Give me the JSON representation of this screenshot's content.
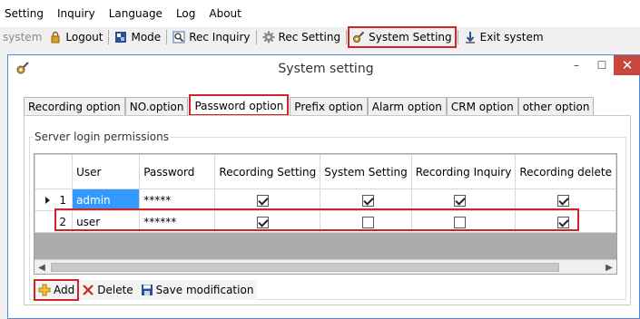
{
  "menu": [
    "Setting",
    "Inquiry",
    "Language",
    "Log",
    "About"
  ],
  "toolbar": {
    "system_label": "system",
    "logout": "Logout",
    "mode": "Mode",
    "rec_inquiry": "Rec Inquiry",
    "rec_setting": "Rec Setting",
    "system_setting": "System Setting",
    "exit_system": "Exit system"
  },
  "dialog": {
    "title": "System setting",
    "min": "–",
    "max": "☐",
    "close": "✕"
  },
  "tabs": [
    "Recording option",
    "NO.option",
    "Password option",
    "Prefix option",
    "Alarm option",
    "CRM option",
    "other option"
  ],
  "active_tab": "Password option",
  "group_label": "Server login permissions",
  "grid": {
    "columns": [
      "User",
      "Password",
      "Recording Setting",
      "System Setting",
      "Recording Inquiry",
      "Recording delete"
    ],
    "rows": [
      {
        "num": "1",
        "user": "admin",
        "password": "*****",
        "rec_setting": true,
        "system_setting": true,
        "rec_inquiry": true,
        "rec_delete": true
      },
      {
        "num": "2",
        "user": "user",
        "password": "******",
        "rec_setting": true,
        "system_setting": false,
        "rec_inquiry": false,
        "rec_delete": true
      }
    ]
  },
  "buttons": {
    "add": "Add",
    "delete": "Delete",
    "save": "Save modification"
  },
  "colors": {
    "highlight": "#d0242a",
    "selection": "#3399ff",
    "close": "#c8463c"
  }
}
